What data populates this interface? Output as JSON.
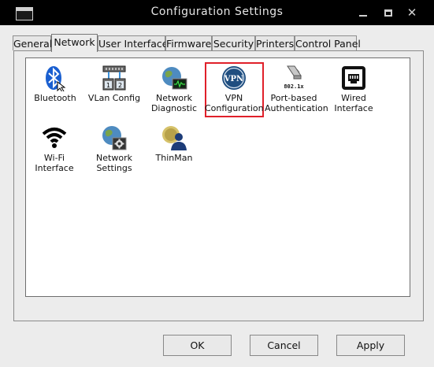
{
  "window": {
    "title": "Configuration Settings"
  },
  "tabs": [
    {
      "label": "General"
    },
    {
      "label": "Network"
    },
    {
      "label": "User Interface"
    },
    {
      "label": "Firmware"
    },
    {
      "label": "Security"
    },
    {
      "label": "Printers"
    },
    {
      "label": "Control Panel"
    }
  ],
  "active_tab": "Network",
  "items": [
    {
      "label": "Bluetooth",
      "icon": "bluetooth-icon"
    },
    {
      "label": "VLan Config",
      "icon": "vlan-config-icon"
    },
    {
      "label": "Network Diagnostic",
      "icon": "network-diagnostic-icon"
    },
    {
      "label": "VPN Configuration",
      "icon": "vpn-icon",
      "icon_text": "VPN"
    },
    {
      "label": "Port-based Authentication",
      "icon": "port-auth-icon",
      "icon_text": "802.1x"
    },
    {
      "label": "Wired Interface",
      "icon": "wired-ethernet-icon"
    },
    {
      "label": "Wi-Fi Interface",
      "icon": "wifi-icon"
    },
    {
      "label": "Network Settings",
      "icon": "network-settings-icon"
    },
    {
      "label": "ThinMan",
      "icon": "thinman-icon"
    }
  ],
  "selected_item": "VPN Configuration",
  "buttons": {
    "ok": "OK",
    "cancel": "Cancel",
    "apply": "Apply"
  },
  "colors": {
    "selection_border": "#e0202a",
    "titlebar": "#000000",
    "accent_blue": "#1a5fd0"
  }
}
